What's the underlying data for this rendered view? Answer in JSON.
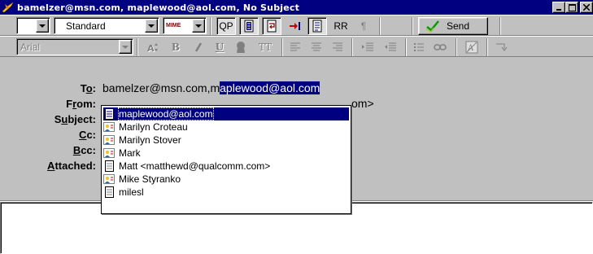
{
  "window": {
    "title": "bamelzer@msn.com, maplewood@aol.com, No Subject",
    "buttons": {
      "minimize": "_",
      "maximize": "□",
      "close": "×"
    }
  },
  "toolbar1": {
    "priority_value": "",
    "format_value": "Standard",
    "mime_label": "MIME",
    "qp_label": "QP",
    "rr_label": "RR",
    "paragraph_label": "¶",
    "send_label": "Send"
  },
  "toolbar2": {
    "font_value": "Arial",
    "bold_label": "B",
    "italic_label": "𝘐",
    "underline_label": "U",
    "tt_label": "TT"
  },
  "headers": {
    "to_label_pre": "T",
    "to_label_u": "o",
    "to_label_post": ":",
    "to_value_plain": "bamelzer@msn.com,m",
    "to_value_selected": "aplewood@aol.com",
    "from_label_pre": "F",
    "from_label_u": "r",
    "from_label_post": "om:",
    "from_value_tail": "om>",
    "subject_label_pre": "S",
    "subject_label_u": "u",
    "subject_label_post": "bject:",
    "cc_label_u": "C",
    "cc_label_post": "c:",
    "bcc_label_u": "B",
    "bcc_label_post": "cc:",
    "attached_label_u": "A",
    "attached_label_post": "ttached:"
  },
  "autocomplete": {
    "items": [
      {
        "label": "maplewood@aol.com",
        "icon": "note-icon",
        "selected": true
      },
      {
        "label": "Marilyn Croteau",
        "icon": "person-card-icon",
        "selected": false
      },
      {
        "label": "Marilyn Stover",
        "icon": "person-card-icon",
        "selected": false
      },
      {
        "label": "Mark",
        "icon": "person-card-icon",
        "selected": false
      },
      {
        "label": "Matt <matthewd@qualcomm.com>",
        "icon": "note-icon",
        "selected": false
      },
      {
        "label": "Mike Styranko",
        "icon": "person-card-icon",
        "selected": false
      },
      {
        "label": "milesl",
        "icon": "note-icon",
        "selected": false
      }
    ]
  },
  "colors": {
    "titlebar": "#000080",
    "selection": "#000080",
    "face": "#c0c0c0",
    "send_check": "#00a000"
  }
}
